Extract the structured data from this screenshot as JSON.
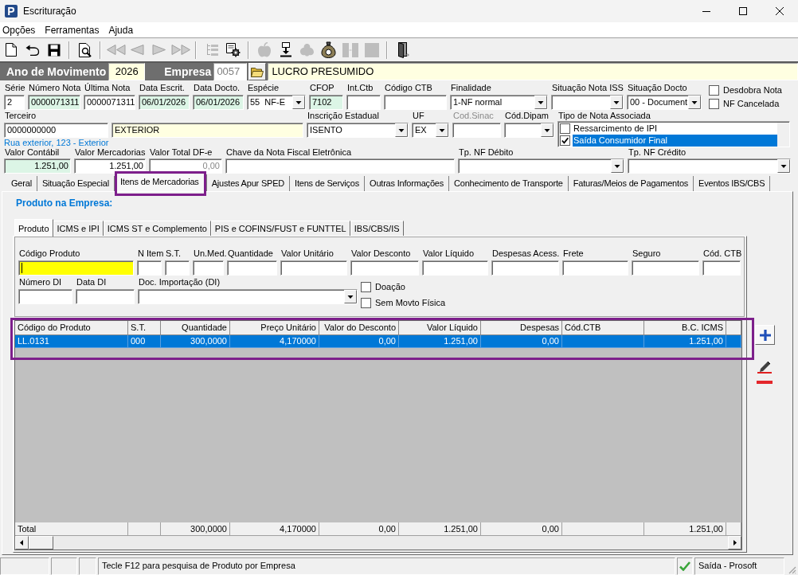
{
  "window": {
    "logo": "P",
    "title": "Escrituração"
  },
  "menu": [
    {
      "label": "Opções"
    },
    {
      "label": "Ferramentas"
    },
    {
      "label": "Ajuda"
    }
  ],
  "toolbar": [
    {
      "disabled": false
    },
    {
      "disabled": false
    },
    {
      "disabled": false
    },
    {
      "disabled": false
    },
    {
      "disabled": true
    },
    {
      "disabled": true
    },
    {
      "disabled": true
    },
    {
      "disabled": true
    },
    {
      "disabled": true
    },
    {
      "disabled": false
    },
    {
      "disabled": true
    },
    {
      "disabled": false
    },
    {
      "disabled": true
    },
    {
      "disabled": false
    },
    {
      "disabled": true
    },
    {
      "disabled": true
    },
    {
      "disabled": false
    }
  ],
  "header": {
    "fields": [
      {
        "label": "Ano de Movimento",
        "value": "2026",
        "disabled": false
      },
      {
        "label": "Empresa",
        "value": "0057",
        "disabled": true
      }
    ],
    "company_name": "LUCRO PRESUMIDO"
  },
  "document": {
    "row_1": [
      {
        "label": "Série",
        "kind": "text",
        "value": "2"
      },
      {
        "label": "Número Nota",
        "kind": "text",
        "value": "0000071311",
        "color": "#dcf5e6"
      },
      {
        "label": "Última Nota",
        "kind": "text",
        "value": "0000071311"
      },
      {
        "label": "Data Escrit.",
        "kind": "text",
        "value": "06/01/2026",
        "color": "#dcf5e6"
      },
      {
        "label": "Data Docto.",
        "kind": "text",
        "value": "06/01/2026",
        "color": "#dcf5e6"
      },
      {
        "label": "Espécie",
        "kind": "select",
        "value": "55  NF-E"
      },
      {
        "label": "CFOP",
        "kind": "text",
        "value": "7102",
        "color": "#dcf5e6"
      },
      {
        "label": "Int.Ctb",
        "kind": "text"
      },
      {
        "label": "Código CTB",
        "kind": "text"
      },
      {
        "label": "Finalidade",
        "kind": "select",
        "value": "1-NF normal"
      },
      {
        "label": "Situação Nota ISS",
        "kind": "select"
      },
      {
        "label": "Situação Docto",
        "kind": "select",
        "value": "00 - Document"
      }
    ],
    "flags": [
      {
        "label": "Desdobra Nota",
        "checked": false
      },
      {
        "label": "NF Cancelada",
        "checked": false
      }
    ],
    "row_2": [
      {
        "label": "Terceiro",
        "kind": "text",
        "value": "0000000000",
        "disabled": false
      },
      {
        "kind": "text",
        "value": "EXTERIOR",
        "color": "#ffffe1",
        "disabled": false
      },
      {
        "label": "Inscrição Estadual",
        "kind": "select",
        "value": "ISENTO",
        "disabled": false
      },
      {
        "label": "UF",
        "kind": "select",
        "value": "EX",
        "disabled": false
      },
      {
        "label": "Cod.Sinac",
        "kind": "text",
        "disabled": true
      },
      {
        "label": "Cód.Dipam",
        "kind": "select",
        "disabled": false
      }
    ],
    "address": "Rua exterior, 123 - Exterior",
    "associated_type": {
      "label": "Tipo de Nota Associada",
      "items": [
        {
          "label": "Ressarcimento de IPI",
          "checked": false,
          "selected": false
        },
        {
          "label": "Saída Consumidor Final",
          "checked": true,
          "selected": true
        }
      ]
    },
    "row_3": [
      {
        "label": "Valor Contábil",
        "kind": "number",
        "value": "1.251,00",
        "color": "#dcf5e6",
        "read_only": false
      },
      {
        "label": "Valor Mercadorias",
        "kind": "number",
        "value": "1.251,00",
        "read_only": false
      },
      {
        "label": "Valor Total DF-e",
        "kind": "number",
        "value": "0,00",
        "read_only": true
      },
      {
        "label": "Chave da Nota Fiscal Eletrônica",
        "kind": "text"
      },
      {
        "label": "Tp. NF Débito",
        "kind": "select"
      },
      {
        "label": "Tp. NF Crédito",
        "kind": "select"
      }
    ]
  },
  "tabs": [
    {
      "label": "Geral",
      "selected": false,
      "highlighted": false
    },
    {
      "label": "Situação Especial",
      "selected": false,
      "highlighted": false
    },
    {
      "label": "Itens de Mercadorias",
      "selected": true,
      "highlighted": true
    },
    {
      "label": "Ajustes Apur SPED",
      "selected": false,
      "highlighted": false
    },
    {
      "label": "Itens de Serviços",
      "selected": false,
      "highlighted": false
    },
    {
      "label": "Outras Informações",
      "selected": false,
      "highlighted": false
    },
    {
      "label": "Conhecimento de Transporte",
      "selected": false,
      "highlighted": false
    },
    {
      "label": "Faturas/Meios de Pagamentos",
      "selected": false,
      "highlighted": false
    },
    {
      "label": "Eventos IBS/CBS",
      "selected": false,
      "highlighted": false
    }
  ],
  "product_panel": {
    "title": "Produto na Empresa:",
    "tabs": [
      {
        "label": "Produto",
        "selected": true
      },
      {
        "label": "ICMS e IPI",
        "selected": false
      },
      {
        "label": "ICMS ST e Complemento",
        "selected": false
      },
      {
        "label": "PIS e COFINS/FUST e FUNTTEL",
        "selected": false
      },
      {
        "label": "IBS/CBS/IS",
        "selected": false
      }
    ],
    "fields_row_1": [
      {
        "label": "Código Produto",
        "kind": "text",
        "color": "#ffff00",
        "focused": true
      },
      {
        "label": "N Item",
        "kind": "text",
        "focused": false
      },
      {
        "label": "S.T.",
        "kind": "text",
        "focused": false
      },
      {
        "label": "Un.Med.",
        "kind": "text",
        "focused": false
      },
      {
        "label": "Quantidade",
        "kind": "text",
        "focused": false
      },
      {
        "label": "Valor Unitário",
        "kind": "text",
        "focused": false
      },
      {
        "label": "Valor Desconto",
        "kind": "text",
        "focused": false
      },
      {
        "label": "Valor Líquido",
        "kind": "text",
        "focused": false
      },
      {
        "label": "Despesas Acess.",
        "kind": "text",
        "focused": false
      },
      {
        "label": "Frete",
        "kind": "text",
        "focused": false
      },
      {
        "label": "Seguro",
        "kind": "text",
        "focused": false
      },
      {
        "label": "Cód. CTB",
        "kind": "text",
        "focused": false
      }
    ],
    "fields_row_2": [
      {
        "label": "Número DI",
        "kind": "text"
      },
      {
        "label": "Data DI",
        "kind": "text"
      },
      {
        "label": "Doc. Importação (DI)",
        "kind": "select"
      }
    ],
    "options": [
      {
        "label": "Doação",
        "checked": false
      },
      {
        "label": "Sem Movto Física",
        "checked": false
      }
    ],
    "grid": {
      "highlighted": true,
      "columns": [
        {
          "label": "Código do Produto",
          "kind": "text",
          "cells": [
            "LL.0131"
          ],
          "total": "Total"
        },
        {
          "label": "S.T.",
          "kind": "text",
          "cells": [
            "000"
          ]
        },
        {
          "label": "Quantidade",
          "kind": "number",
          "cells": [
            "300,0000"
          ],
          "total": "300,0000"
        },
        {
          "label": "Preço Unitário",
          "kind": "number",
          "cells": [
            "4,170000"
          ],
          "total": "4,170000"
        },
        {
          "label": "Valor do Desconto",
          "kind": "number",
          "cells": [
            "0,00"
          ],
          "total": "0,00"
        },
        {
          "label": "Valor Líquido",
          "kind": "number",
          "cells": [
            "1.251,00"
          ],
          "total": "1.251,00"
        },
        {
          "label": "Despesas",
          "kind": "number",
          "cells": [
            "0,00"
          ],
          "total": "0,00"
        },
        {
          "label": "Cód.CTB",
          "kind": "text"
        },
        {
          "label": "B.C. ICMS",
          "kind": "number",
          "cells": [
            "1.251,00"
          ],
          "total": "1.251,00"
        }
      ],
      "rows": [
        {
          "selected": true
        }
      ]
    }
  },
  "status_bar": {
    "message": "Tecle F12 para pesquisa de Produto por Empresa",
    "mode": "Saída - Prosoft"
  }
}
